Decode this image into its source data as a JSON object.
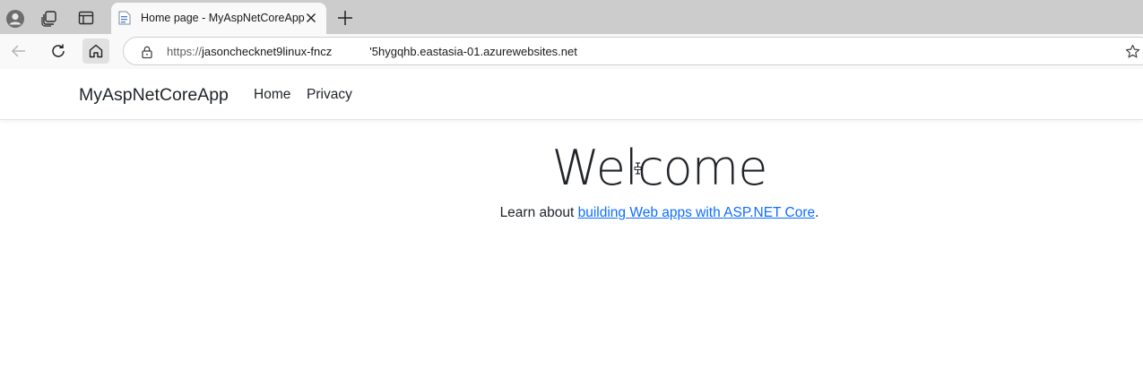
{
  "browser": {
    "profile_icon": "profile-icon",
    "workspaces_icon": "workspaces-icon",
    "vertical_tabs_icon": "tab-actions-icon",
    "tab": {
      "title": "Home page - MyAspNetCoreApp",
      "favicon": "page-favicon-icon",
      "close_icon": "close-icon"
    },
    "new_tab_icon": "plus-icon",
    "back_icon": "back-arrow-icon",
    "refresh_icon": "refresh-icon",
    "home_icon": "home-icon",
    "address": {
      "scheme": "https://",
      "host_part1": "jasonchecknet9linux-fncz",
      "host_part2": "'5hygqhb.eastasia-01.azurewebsites.net",
      "lock_icon": "lock-icon",
      "favorite_icon": "star-icon"
    }
  },
  "site": {
    "brand": "MyAspNetCoreApp",
    "nav": [
      "Home",
      "Privacy"
    ],
    "heading": "Welcome",
    "lead_prefix": "Learn about ",
    "lead_link": "building Web apps with ASP.NET Core",
    "lead_suffix": "."
  },
  "colors": {
    "tabstrip": "#cccccc",
    "toolbar": "#f9f9f9",
    "link": "#0d6efd",
    "text": "#212529"
  }
}
